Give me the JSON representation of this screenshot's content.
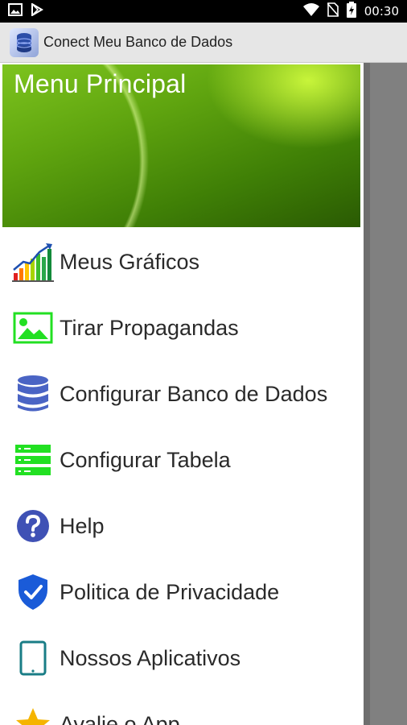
{
  "status_bar": {
    "time": "00:30",
    "icons": [
      "gallery-icon",
      "play-store-icon",
      "wifi-icon",
      "no-sim-icon",
      "battery-icon"
    ]
  },
  "app_bar": {
    "title": "Conect Meu Banco de Dados",
    "icon": "database-app-icon"
  },
  "drawer": {
    "header_title": "Menu Principal",
    "items": [
      {
        "label": "Meus Gráficos",
        "icon": "bar-chart-icon"
      },
      {
        "label": "Tirar Propagandas",
        "icon": "image-icon"
      },
      {
        "label": "Configurar Banco de Dados",
        "icon": "database-icon"
      },
      {
        "label": "Configurar Tabela",
        "icon": "table-rows-icon"
      },
      {
        "label": "Help",
        "icon": "help-circle-icon"
      },
      {
        "label": "Politica de Privacidade",
        "icon": "shield-check-icon"
      },
      {
        "label": "Nossos Aplicativos",
        "icon": "tablet-icon"
      },
      {
        "label": "Avalie o App",
        "icon": "star-icon"
      }
    ]
  },
  "colors": {
    "header_green": "#5fa40f",
    "icon_green": "#22e022",
    "icon_blue": "#3f51b5",
    "tablet_teal": "#1a7d86",
    "star_gold": "#f5b400",
    "scrim": "#808080"
  }
}
